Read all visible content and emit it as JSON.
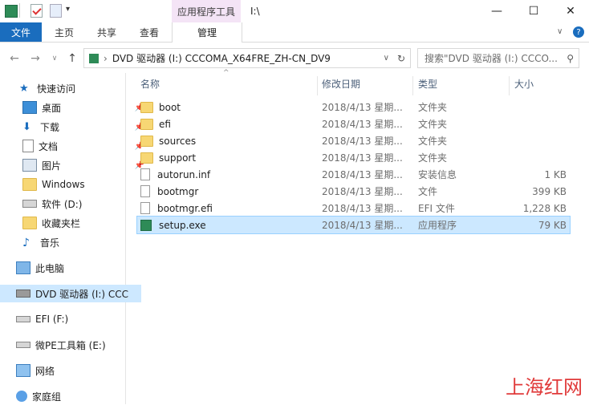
{
  "window": {
    "context_tab_group": "应用程序工具",
    "title": "I:\\",
    "controls": {
      "minimize": "—",
      "maximize": "☐",
      "close": "✕"
    }
  },
  "ribbon": {
    "file": "文件",
    "tabs": [
      "主页",
      "共享",
      "查看"
    ],
    "manage": "管理"
  },
  "address": {
    "path": "DVD 驱动器 (I:) CCCOMA_X64FRE_ZH-CN_DV9",
    "search_placeholder": "搜索\"DVD 驱动器 (I:) CCCO..."
  },
  "sidebar": {
    "items": [
      {
        "label": "快速访问",
        "icon": "star-icon"
      },
      {
        "label": "桌面",
        "icon": "desktop-icon",
        "pinned": true
      },
      {
        "label": "下载",
        "icon": "download-icon",
        "pinned": true
      },
      {
        "label": "文档",
        "icon": "documents-icon",
        "pinned": true
      },
      {
        "label": "图片",
        "icon": "pictures-icon",
        "pinned": true
      },
      {
        "label": "Windows",
        "icon": "folder-icon"
      },
      {
        "label": "软件 (D:)",
        "icon": "drive-icon"
      },
      {
        "label": "收藏夹栏",
        "icon": "folder-icon"
      },
      {
        "label": "音乐",
        "icon": "music-icon"
      },
      {
        "label": "此电脑",
        "icon": "computer-icon"
      },
      {
        "label": "DVD 驱动器 (I:) CCC",
        "icon": "dvd-icon",
        "selected": true
      },
      {
        "label": "EFI (F:)",
        "icon": "drive-icon"
      },
      {
        "label": "微PE工具箱 (E:)",
        "icon": "drive-icon"
      },
      {
        "label": "网络",
        "icon": "network-icon"
      },
      {
        "label": "家庭组",
        "icon": "homegroup-icon"
      }
    ]
  },
  "columns": {
    "name": "名称",
    "date": "修改日期",
    "type": "类型",
    "size": "大小"
  },
  "files": [
    {
      "name": "boot",
      "date": "2018/4/13 星期...",
      "type": "文件夹",
      "size": "",
      "icon": "folder-icon"
    },
    {
      "name": "efi",
      "date": "2018/4/13 星期...",
      "type": "文件夹",
      "size": "",
      "icon": "folder-icon"
    },
    {
      "name": "sources",
      "date": "2018/4/13 星期...",
      "type": "文件夹",
      "size": "",
      "icon": "folder-icon"
    },
    {
      "name": "support",
      "date": "2018/4/13 星期...",
      "type": "文件夹",
      "size": "",
      "icon": "folder-icon"
    },
    {
      "name": "autorun.inf",
      "date": "2018/4/13 星期...",
      "type": "安装信息",
      "size": "1 KB",
      "icon": "settings-file-icon"
    },
    {
      "name": "bootmgr",
      "date": "2018/4/13 星期...",
      "type": "文件",
      "size": "399 KB",
      "icon": "file-icon"
    },
    {
      "name": "bootmgr.efi",
      "date": "2018/4/13 星期...",
      "type": "EFI 文件",
      "size": "1,228 KB",
      "icon": "file-icon"
    },
    {
      "name": "setup.exe",
      "date": "2018/4/13 星期...",
      "type": "应用程序",
      "size": "79 KB",
      "icon": "setup-app-icon",
      "selected": true
    }
  ],
  "watermark": "上海红网",
  "colors": {
    "accent": "#1a6dbe",
    "selection": "#cce8ff",
    "context_tab": "#f4e4f6"
  }
}
